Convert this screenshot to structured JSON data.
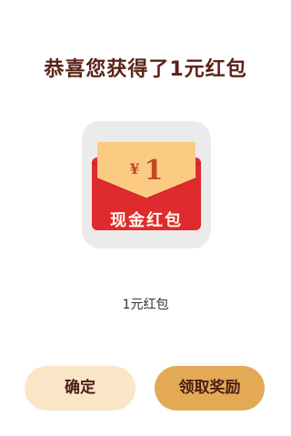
{
  "dialog": {
    "title": "恭喜您获得了1元红包",
    "reward_name": "1元红包"
  },
  "icon": {
    "currency_symbol": "¥",
    "amount": "1",
    "envelope_label": "现金红包"
  },
  "buttons": {
    "confirm_label": "确定",
    "claim_label": "领取奖励"
  },
  "colors": {
    "title": "#5b2316",
    "envelope_red": "#df2b2d",
    "coupon_gold": "#fbcb84",
    "confirm_bg": "#fbe5c7",
    "claim_bg": "#e3a955"
  }
}
